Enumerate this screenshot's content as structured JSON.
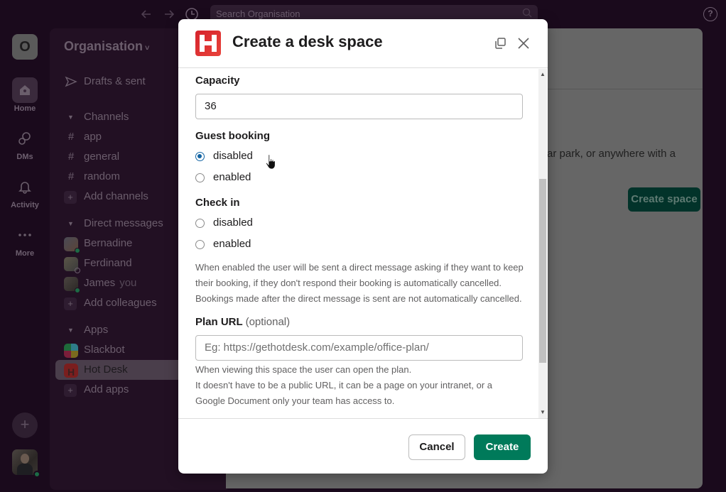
{
  "topbar": {
    "back_icon": "arrow-left-icon",
    "forward_icon": "arrow-right-icon",
    "history_icon": "clock-icon",
    "search_placeholder": "Search Organisation",
    "help_icon": "question-icon",
    "help_glyph": "?"
  },
  "rail": {
    "workspace_initial": "O",
    "items": [
      {
        "label": "Home",
        "icon": "home-icon",
        "active": true
      },
      {
        "label": "DMs",
        "icon": "dms-icon"
      },
      {
        "label": "Activity",
        "icon": "bell-icon"
      },
      {
        "label": "More",
        "icon": "more-icon"
      }
    ],
    "add_glyph": "+"
  },
  "sidebar": {
    "org_name": "Organisation",
    "org_chevron": "˅",
    "drafts": "Drafts & sent",
    "channels_header": "Channels",
    "channels": [
      "app",
      "general",
      "random"
    ],
    "channel_glyph": "#",
    "add_channels": "Add channels",
    "dm_header": "Direct messages",
    "dms": [
      {
        "name": "Bernadine",
        "status": "active"
      },
      {
        "name": "Ferdinand",
        "status": "away"
      },
      {
        "name": "James",
        "suffix": "you",
        "status": "active"
      }
    ],
    "add_colleagues": "Add colleagues",
    "apps_header": "Apps",
    "apps": [
      {
        "name": "Slackbot"
      },
      {
        "name": "Hot Desk",
        "selected": true
      }
    ],
    "add_apps": "Add apps",
    "plus_glyph": "+",
    "caret_glyph": "▼"
  },
  "main": {
    "body_text_fragment": "ar park, or anywhere with a",
    "create_space_button": "Create space"
  },
  "modal": {
    "app_logo_letter": "H",
    "title": "Create a desk space",
    "capacity": {
      "label": "Capacity",
      "value": "36"
    },
    "guest_booking": {
      "label": "Guest booking",
      "options": [
        {
          "label": "disabled",
          "checked": true
        },
        {
          "label": "enabled",
          "checked": false
        }
      ]
    },
    "check_in": {
      "label": "Check in",
      "options": [
        {
          "label": "disabled",
          "checked": false
        },
        {
          "label": "enabled",
          "checked": false
        }
      ],
      "help": "When enabled the user will be sent a direct message asking if they want to keep their booking, if they don't respond their booking is automatically cancelled. Bookings made after the direct message is sent are not automatically cancelled."
    },
    "plan_url": {
      "label": "Plan URL",
      "optional": "(optional)",
      "placeholder": "Eg: https://gethotdesk.com/example/office-plan/",
      "help_line1": "When viewing this space the user can open the plan.",
      "help_line2": "It doesn't have to be a public URL, it can be a page on your intranet, or a Google Document only your team has access to."
    },
    "cancel_button": "Cancel",
    "create_button": "Create"
  },
  "colors": {
    "accent_green": "#007a5a",
    "radio_blue": "#1264a3",
    "brand_red": "#e01e2a",
    "app_bg": "#1a0a1c"
  }
}
